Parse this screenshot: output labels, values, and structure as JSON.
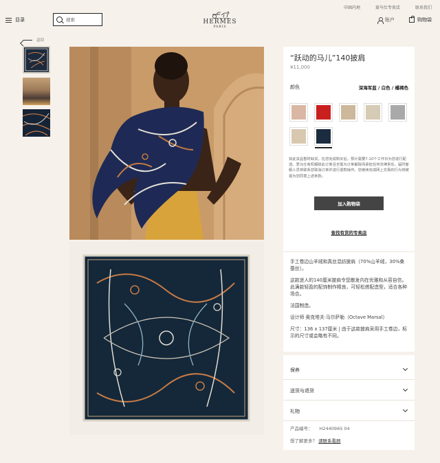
{
  "util_links": [
    "中国内地",
    "爱马仕专卖店",
    "联系我们"
  ],
  "header": {
    "menu_label": "目录",
    "search_placeholder": "搜索",
    "logo_name": "HERMES",
    "logo_sub": "PARIS",
    "account_label": "账户",
    "cart_label": "购物袋"
  },
  "back_label": "返回",
  "product": {
    "title": "“跃动的马儿”140披肩",
    "price": "¥11,000",
    "color_label": "颜色",
    "color_value": "深海军蓝 / 白色 / 橘褐色",
    "swatches": [
      "#d9b7a4",
      "#c9201f",
      "#cdb89b",
      "#d6cbb4",
      "#a9a9a9",
      "#d8c8b0",
      "#1c2c40"
    ],
    "notice": "如此货品暂时缺货，在您完成购买后，预计需要7-10个工作日为您进行配送。爱马仕有权解除此订单且无需为订单解除而承担任何法律责任，届时客服人员将联系您取消订单并进行退款操作。您继续完成网上交易的行为将被视为您同意上述条款。",
    "add_button": "加入购物袋",
    "store_link": "查找有货的专卖店"
  },
  "description": {
    "p1": "手工卷边山羊绒和真丝混纺披肩（70%山羊绒，30%桑蚕丝）。",
    "p2": "这款迷人的140厘米披肩令您散发内在优雅和从容自信。此满款轻盈的配饰制作精良，可轻松搭配造型，适合各种场合。",
    "p3": "法国制造。",
    "p4": "设计师 奥克塔夫·马尔萨勒（Octave Marsal）",
    "p5": "尺寸：136 x 137厘米 | 由于这款披肩采用手工卷边，标示的尺寸或会略有不同。"
  },
  "accordion": [
    "保养",
    "送货与退货",
    "礼物"
  ],
  "product_code_label": "产品编号：",
  "product_code": "H244096S 04",
  "contact_prefix": "想了解更多？",
  "contact_link": "请联系看顾"
}
